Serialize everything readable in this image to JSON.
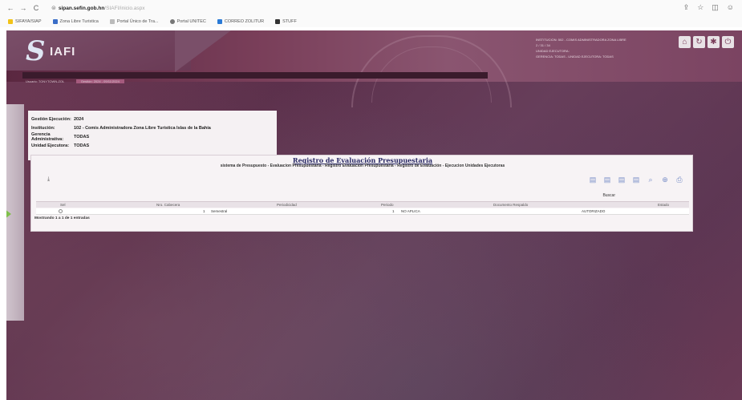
{
  "browser": {
    "url_domain": "sipan.sefin.gob.hn",
    "url_path": "/SIAFI/inicio.aspx",
    "bookmarks": [
      "SIFAYA/SIAP",
      "Zona Libre Turistica",
      "Portal Único de Tra...",
      "Portal UNITEC",
      "CORREO ZOLITUR",
      "STUFF"
    ]
  },
  "header": {
    "logo_text": "IAFI",
    "info_bar_left": "Usuario: TONYTOWN-ZOL",
    "info_bar_tag": "Gestión: 2024 - 09/11/2024",
    "user_lines": [
      "INSTITUCION: 502 - COMIS ADMINISTRADORA ZONA LIBRE",
      "2 / 31 / 34",
      "UNIDAD EJECUTORA:",
      "GERENCIA: TODAS - UNIDAD EJECUTORA: TODAS"
    ]
  },
  "context": {
    "rows": [
      {
        "label": "Gestión Ejecución:",
        "value": "2024"
      },
      {
        "label": "Institución:",
        "value": "102 - Comis Administradora Zona Libre Turistica Islas de la Bahía"
      },
      {
        "label": "Gerencia Administrativa:",
        "value": "TODAS"
      },
      {
        "label": "Unidad Ejecutora:",
        "value": "TODAS"
      }
    ]
  },
  "panel": {
    "title": "Registro de Evaluación Presupuestaria",
    "subtitle": "sistema de Presupuesto - Evaluacion Presupuestaria - Registro Evaluacion Presupuestaria - Registro de Evaluación - Ejecucion Unidades Ejecutoras",
    "search_label": "Buscar",
    "columns": [
      "Sel",
      "Nro. Cabecera",
      "Periodicidad",
      "Periodo",
      "Documento Respaldo",
      "Estado"
    ],
    "rows": [
      {
        "nro": "1",
        "periodicidad": "Semestral",
        "periodo": "1",
        "documento": "NO APLICA",
        "estado": "AUTORIZADO"
      }
    ],
    "footer": "Mostrando 1 a 1 de 1 entradas"
  }
}
